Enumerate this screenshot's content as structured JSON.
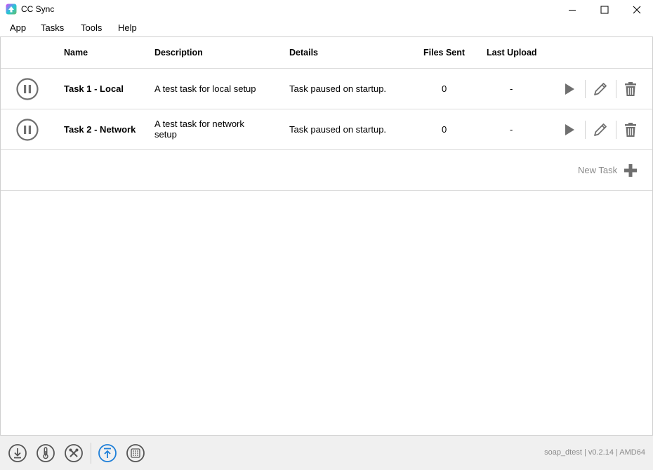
{
  "window": {
    "title": "CC Sync",
    "controls": [
      "minimize-icon",
      "maximize-icon",
      "close-icon"
    ]
  },
  "menu": {
    "items": [
      "App",
      "Tasks",
      "Tools",
      "Help"
    ]
  },
  "table": {
    "headers": {
      "name": "Name",
      "description": "Description",
      "details": "Details",
      "files_sent": "Files Sent",
      "last_upload": "Last Upload"
    },
    "rows": [
      {
        "status_icon": "pause-circle-icon",
        "name": "Task 1 - Local",
        "description": "A test task for local setup",
        "details": "Task paused on startup.",
        "files_sent": "0",
        "last_upload": "-"
      },
      {
        "status_icon": "pause-circle-icon",
        "name": "Task 2 - Network",
        "description": "A test task for network setup",
        "details": "Task paused on startup.",
        "files_sent": "0",
        "last_upload": "-"
      }
    ],
    "row_actions": [
      "play-icon",
      "pencil-icon",
      "trash-icon"
    ]
  },
  "new_task": {
    "label": "New Task",
    "icon": "plus-icon"
  },
  "bottom_toolbar": {
    "icons": [
      "download-icon",
      "thermometer-icon",
      "tools-icon",
      "upload-icon",
      "grid-icon"
    ],
    "active_icon": "upload-icon",
    "accent_color": "#1e7fd8",
    "version_text": "soap_dtest | v0.2.14 | AMD64"
  },
  "colors": {
    "icon_gray": "#6f6f6f",
    "border": "#dcdcdc",
    "muted_text": "#8a8a8a"
  }
}
